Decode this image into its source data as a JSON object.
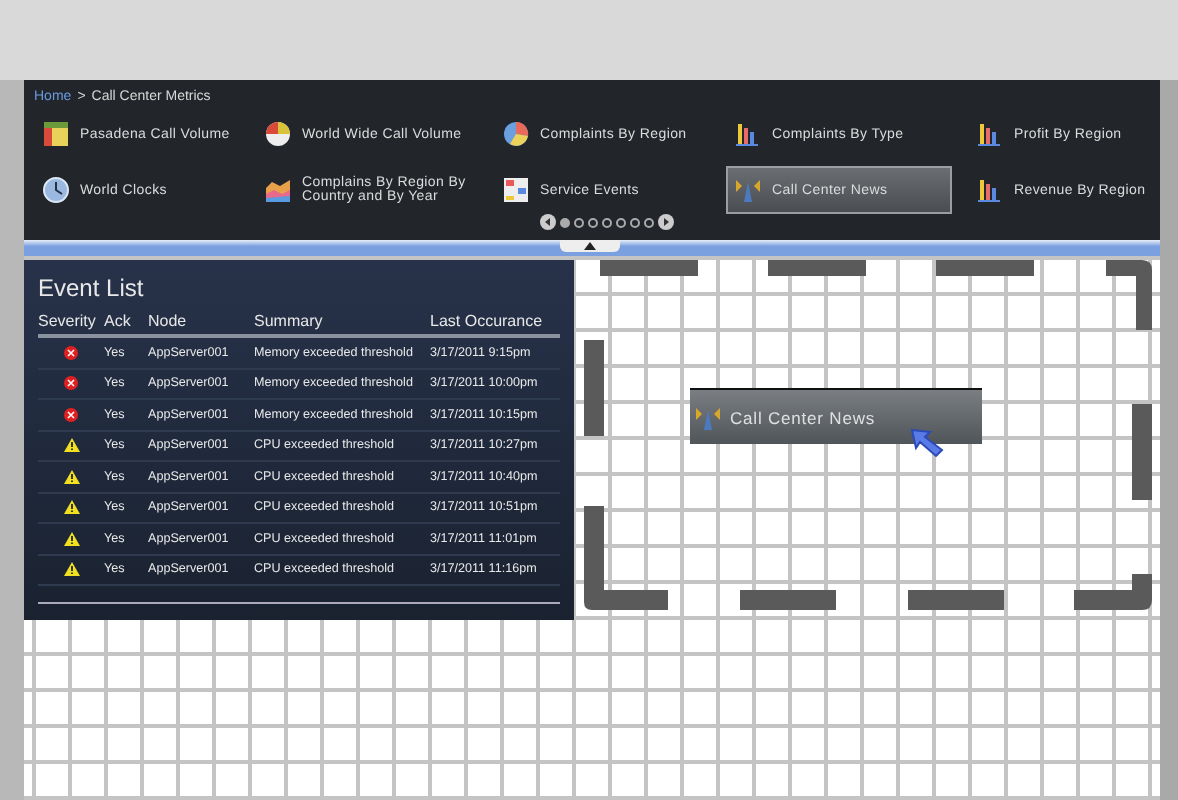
{
  "breadcrumb": {
    "link": "Home",
    "separator": ">",
    "current": "Call Center Metrics"
  },
  "widgets": [
    {
      "label": "Pasadena Call Volume",
      "kind": "table",
      "selected": false
    },
    {
      "label": "World Wide Call Volume",
      "kind": "gauge",
      "selected": false
    },
    {
      "label": "Complaints By Region",
      "kind": "pie",
      "selected": false
    },
    {
      "label": "Complaints By Type",
      "kind": "bars",
      "selected": false
    },
    {
      "label": "Profit By Region",
      "kind": "bars",
      "selected": false
    },
    {
      "label": "World Clocks",
      "kind": "clock",
      "selected": false
    },
    {
      "label": "Complains By Region By Country and By Year",
      "kind": "area",
      "selected": false
    },
    {
      "label": "Service Events",
      "kind": "grid",
      "selected": false
    },
    {
      "label": "Call Center News",
      "kind": "antenna",
      "selected": true
    },
    {
      "label": "Revenue By Region",
      "kind": "bars",
      "selected": false
    }
  ],
  "pager": [
    {
      "selected": true
    },
    {
      "selected": false
    },
    {
      "selected": false
    },
    {
      "selected": false
    },
    {
      "selected": false
    },
    {
      "selected": false
    },
    {
      "selected": false
    }
  ],
  "event_list": {
    "title": "Event List",
    "columns": [
      "Severity",
      "Ack",
      "Node",
      "Summary",
      "Last Occurance"
    ],
    "rows": [
      {
        "kind": "critical",
        "ack": "Yes",
        "node": "AppServer001",
        "summary": "Memory exceeded threshold",
        "last": "3/17/2011 9:15pm"
      },
      {
        "kind": "critical",
        "ack": "Yes",
        "node": "AppServer001",
        "summary": "Memory exceeded threshold",
        "last": "3/17/2011 10:00pm"
      },
      {
        "kind": "critical",
        "ack": "Yes",
        "node": "AppServer001",
        "summary": "Memory exceeded threshold",
        "last": "3/17/2011 10:15pm"
      },
      {
        "kind": "warning",
        "ack": "Yes",
        "node": "AppServer001",
        "summary": "CPU exceeded threshold",
        "last": "3/17/2011 10:27pm"
      },
      {
        "kind": "warning",
        "ack": "Yes",
        "node": "AppServer001",
        "summary": "CPU exceeded threshold",
        "last": "3/17/2011 10:40pm"
      },
      {
        "kind": "warning",
        "ack": "Yes",
        "node": "AppServer001",
        "summary": "CPU exceeded threshold",
        "last": "3/17/2011 10:51pm"
      },
      {
        "kind": "warning",
        "ack": "Yes",
        "node": "AppServer001",
        "summary": "CPU exceeded threshold",
        "last": "3/17/2011 11:01pm"
      },
      {
        "kind": "warning",
        "ack": "Yes",
        "node": "AppServer001",
        "summary": "CPU exceeded threshold",
        "last": "3/17/2011 11:16pm"
      }
    ]
  },
  "drag_preview": {
    "label": "Call Center News",
    "kind": "antenna"
  }
}
